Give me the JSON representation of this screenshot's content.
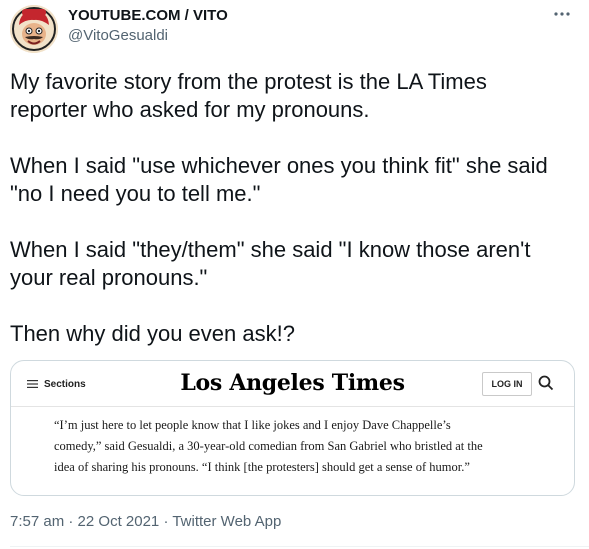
{
  "author": {
    "name": "YOUTUBE.COM / VITO",
    "handle": "@VitoGesualdi"
  },
  "tweet": {
    "paragraphs": [
      [
        "My favorite story from the protest is the LA Times",
        "reporter who asked for my pronouns."
      ],
      [
        "When I said \"use whichever ones you think fit\" she said",
        "\"no I need you to tell me.\""
      ],
      [
        "When I said \"they/them\" she said \"I know those aren't",
        "your real pronouns.\""
      ],
      [
        "Then why did you even ask!?"
      ]
    ]
  },
  "card": {
    "sections_label": "Sections",
    "logo_text": "Los Angeles Times",
    "login_label": "LOG IN",
    "quote_lines": [
      "“I’m just here to let people know that I like jokes and I enjoy Dave Chappelle’s",
      "comedy,” said Gesualdi, a 30-year-old comedian from San Gabriel who bristled at the",
      "idea of sharing his pronouns. “I think [the protesters] should get a sense of humor.”"
    ]
  },
  "meta": {
    "time": "7:57 am",
    "separator": " · ",
    "date": "22 Oct 2021",
    "source": "Twitter Web App"
  },
  "icons": {
    "more": "more-horizontal-icon",
    "menu": "hamburger-menu-icon",
    "search": "search-icon"
  },
  "colors": {
    "text": "#0f1419",
    "secondary": "#536471",
    "border": "#cfd9de"
  }
}
